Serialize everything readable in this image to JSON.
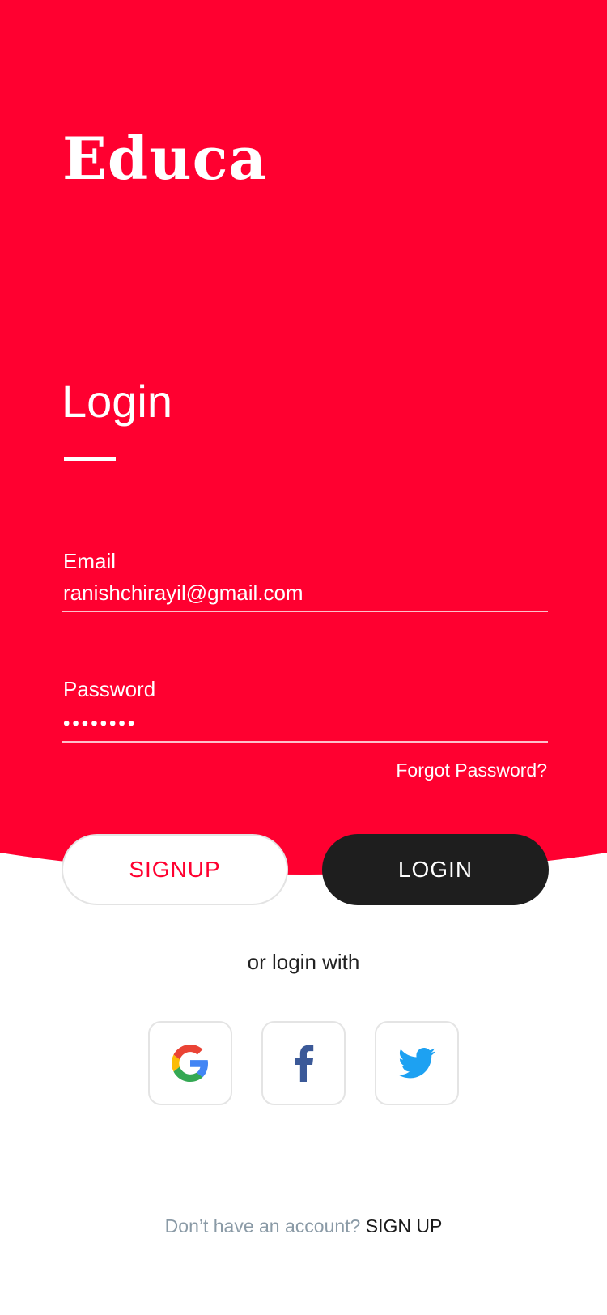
{
  "app": {
    "logo_text": "Educa"
  },
  "login_form": {
    "title": "Login",
    "email_label": "Email",
    "email_value": "ranishchirayil@gmail.com",
    "password_label": "Password",
    "password_value": "••••••••",
    "forgot_password": "Forgot Password?"
  },
  "actions": {
    "signup_label": "SIGNUP",
    "login_label": "LOGIN"
  },
  "social": {
    "divider_text": "or login with",
    "providers": [
      {
        "name": "google",
        "icon": "google-icon"
      },
      {
        "name": "facebook",
        "icon": "facebook-icon"
      },
      {
        "name": "twitter",
        "icon": "twitter-icon"
      }
    ]
  },
  "footer": {
    "prompt_text": "Don’t have an account?",
    "signup_link": "SIGN UP"
  },
  "colors": {
    "primary_red": "#FF0030",
    "dark_button": "#1E1E1E",
    "muted_text": "#8A9AA6",
    "facebook_blue": "#3B5998",
    "twitter_blue": "#1DA1F2"
  }
}
